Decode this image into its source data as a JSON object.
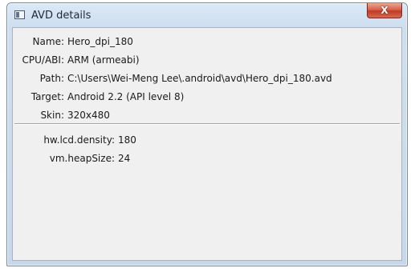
{
  "window": {
    "title": "AVD details",
    "close_glyph": "X",
    "icon": "window-app-icon"
  },
  "details": [
    {
      "label": "Name:",
      "value": "Hero_dpi_180"
    },
    {
      "label": "CPU/ABI:",
      "value": "ARM (armeabi)"
    },
    {
      "label": "Path:",
      "value": "C:\\Users\\Wei-Meng Lee\\.android\\avd\\Hero_dpi_180.avd"
    },
    {
      "label": "Target:",
      "value": "Android 2.2 (API level 8)"
    },
    {
      "label": "Skin:",
      "value": "320x480"
    }
  ],
  "properties": [
    {
      "label": "hw.lcd.density:",
      "value": "180"
    },
    {
      "label": "vm.heapSize:",
      "value": "24"
    }
  ]
}
